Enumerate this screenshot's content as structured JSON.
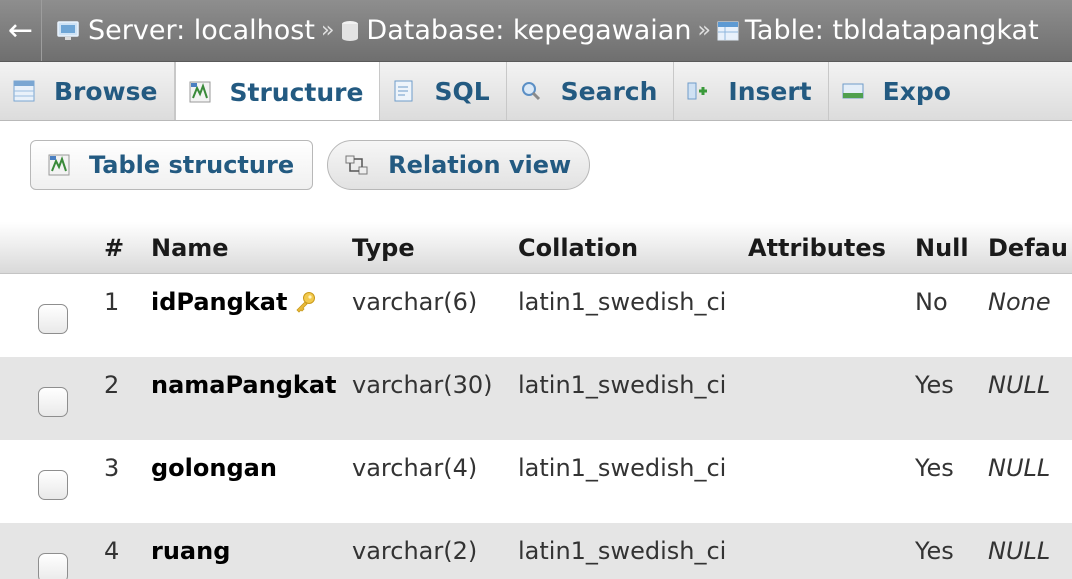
{
  "breadcrumb": {
    "back": "←",
    "server": "Server: localhost",
    "database": "Database: kepegawaian",
    "table": "Table: tbldatapangkat",
    "separator": "»"
  },
  "tabs": [
    {
      "label": "Browse",
      "icon": "browse-icon",
      "active": false
    },
    {
      "label": "Structure",
      "icon": "structure-icon",
      "active": true
    },
    {
      "label": "SQL",
      "icon": "sql-icon",
      "active": false
    },
    {
      "label": "Search",
      "icon": "search-icon",
      "active": false
    },
    {
      "label": "Insert",
      "icon": "insert-icon",
      "active": false
    },
    {
      "label": "Expo",
      "icon": "export-icon",
      "active": false
    }
  ],
  "subtabs": {
    "table_structure": "Table structure",
    "relation_view": "Relation view"
  },
  "table": {
    "headers": {
      "num": "#",
      "name": "Name",
      "type": "Type",
      "collation": "Collation",
      "attributes": "Attributes",
      "null": "Null",
      "default": "Defau"
    },
    "rows": [
      {
        "num": "1",
        "name": "idPangkat",
        "type": "varchar(6)",
        "collation": "latin1_swedish_ci",
        "attributes": "",
        "null": "No",
        "default": "None",
        "primary_key": true
      },
      {
        "num": "2",
        "name": "namaPangkat",
        "type": "varchar(30)",
        "collation": "latin1_swedish_ci",
        "attributes": "",
        "null": "Yes",
        "default": "NULL",
        "primary_key": false
      },
      {
        "num": "3",
        "name": "golongan",
        "type": "varchar(4)",
        "collation": "latin1_swedish_ci",
        "attributes": "",
        "null": "Yes",
        "default": "NULL",
        "primary_key": false
      },
      {
        "num": "4",
        "name": "ruang",
        "type": "varchar(2)",
        "collation": "latin1_swedish_ci",
        "attributes": "",
        "null": "Yes",
        "default": "NULL",
        "primary_key": false
      }
    ]
  },
  "colors": {
    "link": "#235a81",
    "row_alt": "#e5e5e5",
    "breadcrumb_bg": "#7f7f7f"
  }
}
